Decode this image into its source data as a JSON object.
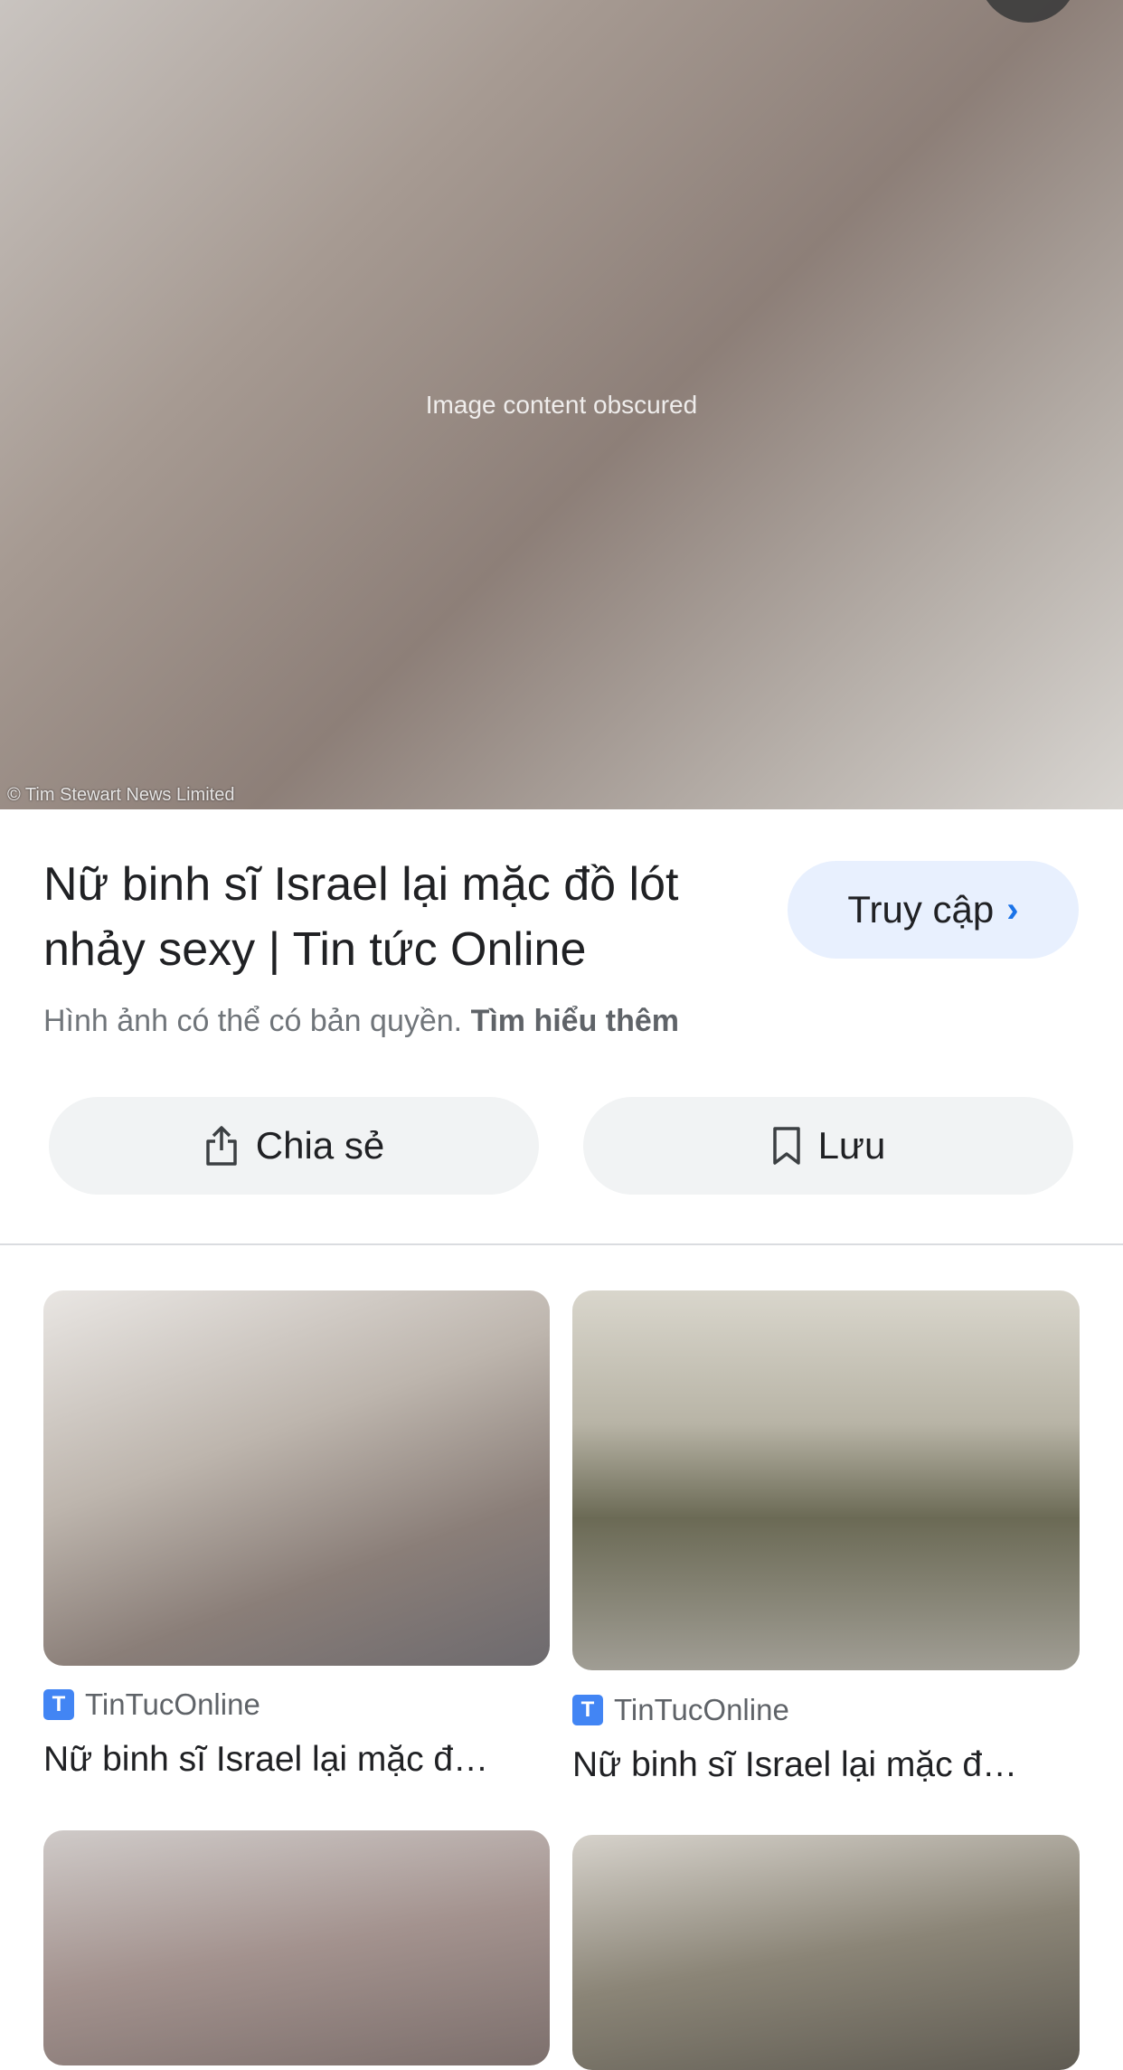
{
  "hero": {
    "image_note": "Image content obscured",
    "credit": "© Tim Stewart News Limited"
  },
  "result": {
    "title_line1": "Nữ binh sĩ Israel lại mặc đồ lót",
    "title_line2": "nhảy sexy | Tin tức Online",
    "visit_label": "Truy cập",
    "copyright_text": "Hình ảnh có thể có bản quyền.",
    "learn_more": "Tìm hiểu thêm"
  },
  "actions": {
    "share_label": "Chia sẻ",
    "save_label": "Lưu"
  },
  "related": [
    {
      "source": "TinTucOnline",
      "caption": "Nữ binh sĩ Israel lại mặc đ…"
    },
    {
      "source": "TinTucOnline",
      "caption": "Nữ binh sĩ Israel lại mặc đ…"
    }
  ],
  "favicon_letter": "T",
  "colors": {
    "visit_bg": "#e8f0fe",
    "accent": "#1a73e8",
    "button_bg": "#f1f3f4",
    "favicon": "#4285f4"
  }
}
